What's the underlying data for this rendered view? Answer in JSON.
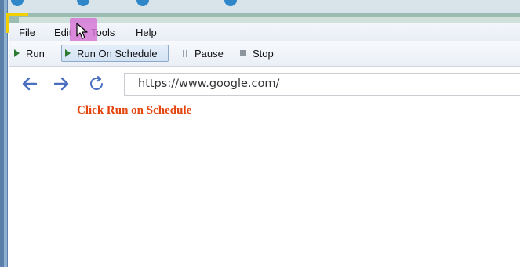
{
  "menubar": {
    "items": [
      "File",
      "Edit",
      "Tools",
      "Help"
    ]
  },
  "toolbar": {
    "run": "Run",
    "run_on_schedule": "Run On Schedule",
    "pause": "Pause",
    "stop": "Stop"
  },
  "browser": {
    "url": "https://www.google.com/"
  },
  "instruction": "Click Run on Schedule",
  "colors": {
    "instruction": "#e5450d",
    "highlight": "#d678d6",
    "accent": "#4a6fc0"
  },
  "icons": [
    "back-arrow-icon",
    "forward-arrow-icon",
    "refresh-icon",
    "play-icon",
    "pause-icon",
    "stop-icon",
    "mouse-cursor-icon"
  ]
}
